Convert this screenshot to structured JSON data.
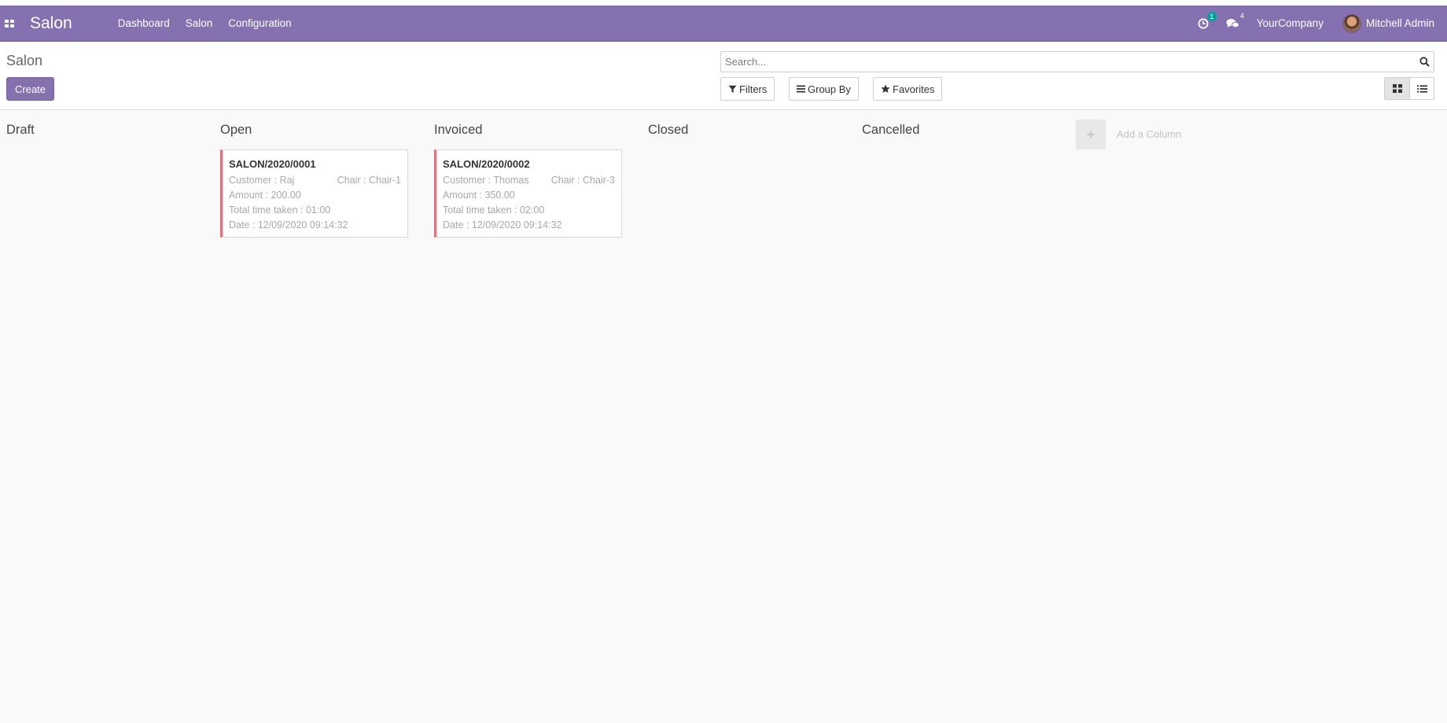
{
  "navbar": {
    "brand": "Salon",
    "menu": [
      "Dashboard",
      "Salon",
      "Configuration"
    ],
    "activity_count": "1",
    "messages_count": "4",
    "company": "YourCompany",
    "user": "Mitchell Admin"
  },
  "control_panel": {
    "title": "Salon",
    "create_label": "Create",
    "search_placeholder": "Search...",
    "filters_label": "Filters",
    "group_by_label": "Group By",
    "favorites_label": "Favorites"
  },
  "kanban": {
    "columns": [
      "Draft",
      "Open",
      "Invoiced",
      "Closed",
      "Cancelled"
    ],
    "cards": [
      {
        "title": "SALON/2020/0001",
        "customer": "Customer : Raj",
        "chair": "Chair : Chair-1",
        "amount": "Amount : 200.00",
        "time": "Total time taken : 01:00",
        "date": "Date : 12/09/2020 09:14:32"
      },
      {
        "title": "SALON/2020/0002",
        "customer": "Customer : Thomas",
        "chair": "Chair : Chair-3",
        "amount": "Amount : 350.00",
        "time": "Total time taken : 02:00",
        "date": "Date : 12/09/2020 09:14:32"
      }
    ],
    "add_column_label": "Add a Column"
  },
  "colors": {
    "primary": "#8570b0",
    "card_accent": "#e36d7a",
    "badge": "#00a09d"
  },
  "icons": [
    "apps-grid-icon",
    "clock-icon",
    "chat-icon",
    "search-icon",
    "filter-icon",
    "bars-icon",
    "star-icon",
    "kanban-view-icon",
    "list-view-icon",
    "plus-icon"
  ]
}
